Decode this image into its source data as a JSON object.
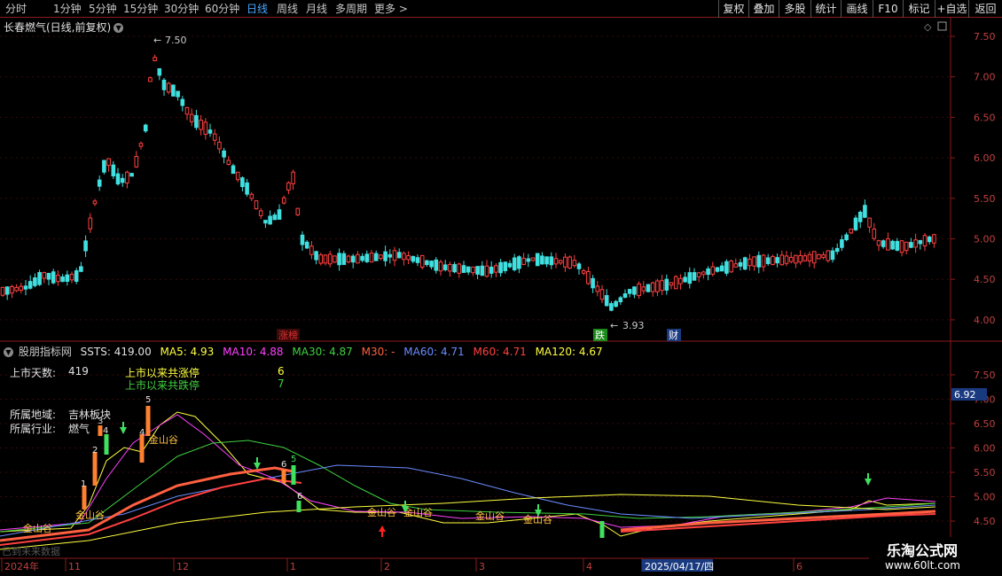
{
  "toolbar": {
    "periods": [
      "分时",
      "1分钟",
      "5分钟",
      "15分钟",
      "30分钟",
      "60分钟",
      "日线",
      "周线",
      "月线",
      "多周期",
      "更多 >"
    ],
    "active_period": "日线",
    "right_buttons": [
      "复权",
      "叠加",
      "多股",
      "统计",
      "画线",
      "F10",
      "标记",
      "+自选",
      "返回"
    ]
  },
  "main_chart": {
    "title": "长春燃气(日线,前复权)",
    "high_label": "7.50",
    "low_label": "3.93",
    "price_ticks": [
      "7.50",
      "7.00",
      "6.50",
      "6.00",
      "5.50",
      "5.00",
      "4.50",
      "4.00"
    ],
    "event_markers": [
      {
        "text": "涨榜",
        "color": "#e03030"
      },
      {
        "text": "跌",
        "color": "#1a8a1a"
      },
      {
        "text": "财",
        "color": "#1a4aa0"
      }
    ]
  },
  "indicator": {
    "name": "股朋指标网",
    "legend": [
      {
        "label": "SSTS: 419.00",
        "color": "#e0e0e0"
      },
      {
        "label": "MA5: 4.93",
        "color": "#ffff40"
      },
      {
        "label": "MA10: 4.88",
        "color": "#ff40ff"
      },
      {
        "label": "MA30: 4.87",
        "color": "#40d040"
      },
      {
        "label": "M30: -",
        "color": "#ff6040"
      },
      {
        "label": "MA60: 4.71",
        "color": "#6a8cff"
      },
      {
        "label": "M60: 4.71",
        "color": "#ff4040"
      },
      {
        "label": "MA120: 4.67",
        "color": "#ffff40"
      }
    ],
    "ticks": [
      "7.50",
      "7.00",
      "6.50",
      "6.00",
      "5.50",
      "5.00",
      "4.50"
    ],
    "current_price": "6.92",
    "info": {
      "listing_days_label": "上市天数:",
      "listing_days_value": "419",
      "limit_up_label": "上市以来共涨停",
      "limit_up_value": "6",
      "limit_down_label": "上市以来共跌停",
      "limit_down_value": "7",
      "region_label": "所属地域:",
      "region_value": "吉林板块",
      "industry_label": "所属行业:",
      "industry_value": "燃气"
    },
    "signal_label": "金山谷",
    "count_labels": [
      "1",
      "2",
      "3",
      "4",
      "4",
      "5",
      "6",
      "5",
      "6"
    ],
    "bottom_note": "已到未来数据"
  },
  "x_axis": {
    "labels": [
      "2024年",
      "11",
      "12",
      "1",
      "2",
      "3",
      "4",
      "2025/04/17/四",
      "6"
    ]
  },
  "watermark": {
    "line1": "乐淘公式网",
    "line2": "www.60lt.com"
  }
}
